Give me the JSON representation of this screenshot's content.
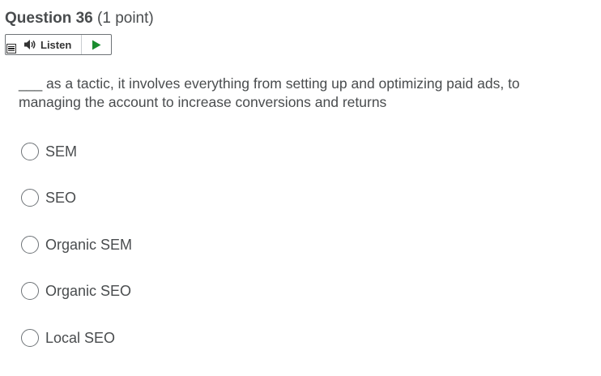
{
  "question": {
    "title": "Question 36",
    "points": "(1 point)"
  },
  "listen_bar": {
    "listen_label": "Listen"
  },
  "question_text": "___ as a tactic, it involves everything from setting up and optimizing paid ads, to managing the account to increase conversions and returns",
  "options": [
    {
      "label": "SEM",
      "selected": false
    },
    {
      "label": "SEO",
      "selected": false
    },
    {
      "label": "Organic SEM",
      "selected": false
    },
    {
      "label": "Organic SEO",
      "selected": false
    },
    {
      "label": "Local SEO",
      "selected": false
    }
  ],
  "colors": {
    "text": "#494c4e",
    "play_icon": "#1a8c2e",
    "border": "#6e7377"
  },
  "icons": {
    "menu": "menu-icon",
    "speaker": "speaker-icon",
    "play": "play-icon"
  }
}
